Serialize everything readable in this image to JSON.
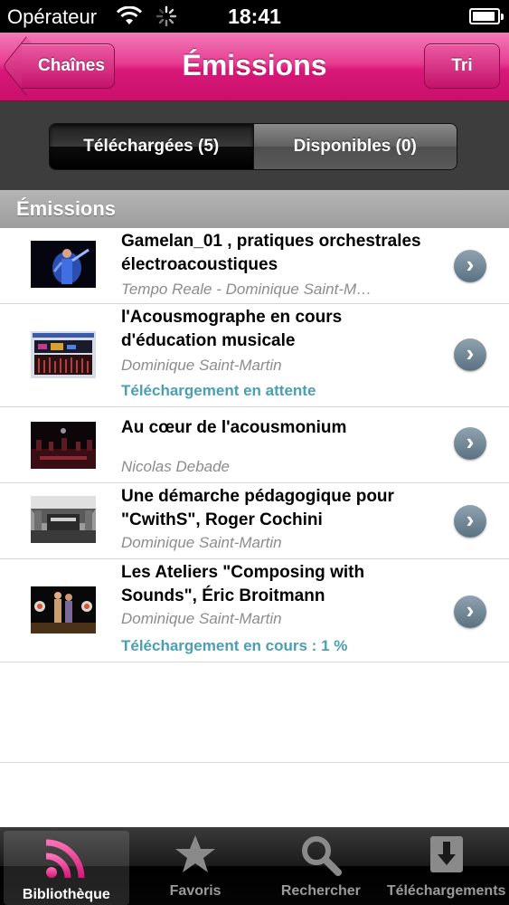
{
  "status_bar": {
    "carrier": "Opérateur",
    "time": "18:41"
  },
  "nav": {
    "back_label": "Chaînes",
    "title": "Émissions",
    "sort_label": "Tri"
  },
  "segments": {
    "downloaded": "Téléchargées (5)",
    "available": "Disponibles (0)"
  },
  "section_header": "Émissions",
  "items": [
    {
      "title": "Gamelan_01  , pratiques orchestrales électroacoustiques",
      "author": "Tempo Reale - Dominique Saint-M…",
      "status": "",
      "thumb_icon": "conductor-thumbnail"
    },
    {
      "title": "l'Acousmographe en cours d'éducation musicale",
      "author": "Dominique Saint-Martin",
      "status": "Téléchargement en attente",
      "thumb_icon": "software-screenshot-thumbnail"
    },
    {
      "title": "Au cœur de l'acousmonium",
      "author": "Nicolas Debade",
      "status": "",
      "thumb_icon": "concert-hall-thumbnail"
    },
    {
      "title": "Une démarche pédagogique pour \"CwithS\", Roger Cochini",
      "author": "Dominique Saint-Martin",
      "status": "",
      "thumb_icon": "studio-thumbnail"
    },
    {
      "title": "Les Ateliers \"Composing with Sounds\", Éric Broitmann",
      "author": "Dominique Saint-Martin",
      "status": "Téléchargement en cours : 1 %",
      "thumb_icon": "workshop-thumbnail"
    }
  ],
  "tabs": [
    {
      "label": "Bibliothèque",
      "icon": "rss-icon",
      "selected": true
    },
    {
      "label": "Favoris",
      "icon": "star-icon",
      "selected": false
    },
    {
      "label": "Rechercher",
      "icon": "search-icon",
      "selected": false
    },
    {
      "label": "Téléchargements",
      "icon": "download-icon",
      "selected": false
    }
  ],
  "colors": {
    "nav_pink": "#d91878",
    "status_link": "#4a9fb5",
    "rss_accent": "#e8338c"
  }
}
